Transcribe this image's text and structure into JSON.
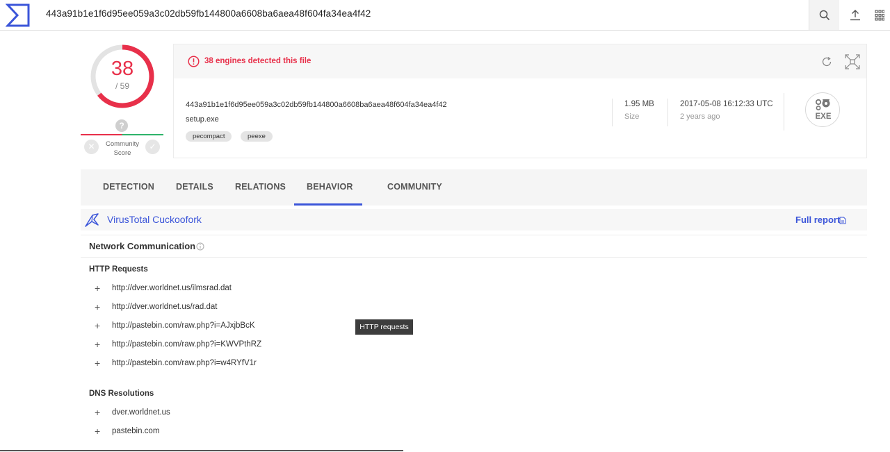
{
  "search": {
    "query": "443a91b1e1f6d95ee059a3c02db59fb144800a6608ba6aea48f604fa34ea4f42"
  },
  "score": {
    "detected": "38",
    "total": "/ 59",
    "ring_fraction": 0.644
  },
  "community": {
    "label_line1": "Community",
    "label_line2": "Score"
  },
  "file": {
    "alert": "38 engines detected this file",
    "hash": "443a91b1e1f6d95ee059a3c02db59fb144800a6608ba6aea48f604fa34ea4f42",
    "name": "setup.exe",
    "tags": [
      "pecompact",
      "peexe"
    ],
    "size_value": "1.95 MB",
    "size_label": "Size",
    "date_value": "2017-05-08 16:12:33 UTC",
    "date_relative": "2 years ago",
    "type_badge": "EXE"
  },
  "tabs": [
    {
      "label": "DETECTION"
    },
    {
      "label": "DETAILS"
    },
    {
      "label": "RELATIONS"
    },
    {
      "label": "BEHAVIOR",
      "active": true
    },
    {
      "label": "COMMUNITY"
    }
  ],
  "sandbox": {
    "name": "VirusTotal Cuckoofork",
    "full_report": "Full report"
  },
  "network": {
    "title": "Network Communication",
    "http_title": "HTTP Requests",
    "http": [
      "http://dver.worldnet.us/ilmsrad.dat",
      "http://dver.worldnet.us/rad.dat",
      "http://pastebin.com/raw.php?i=AJxjbBcK",
      "http://pastebin.com/raw.php?i=KWVPthRZ",
      "http://pastebin.com/raw.php?i=w4RYfV1r"
    ],
    "dns_title": "DNS Resolutions",
    "dns": [
      "dver.worldnet.us",
      "pastebin.com"
    ]
  },
  "tooltip": "HTTP requests",
  "colors": {
    "accent": "#3b55d9",
    "danger": "#e8304a",
    "success": "#2fb36b"
  }
}
